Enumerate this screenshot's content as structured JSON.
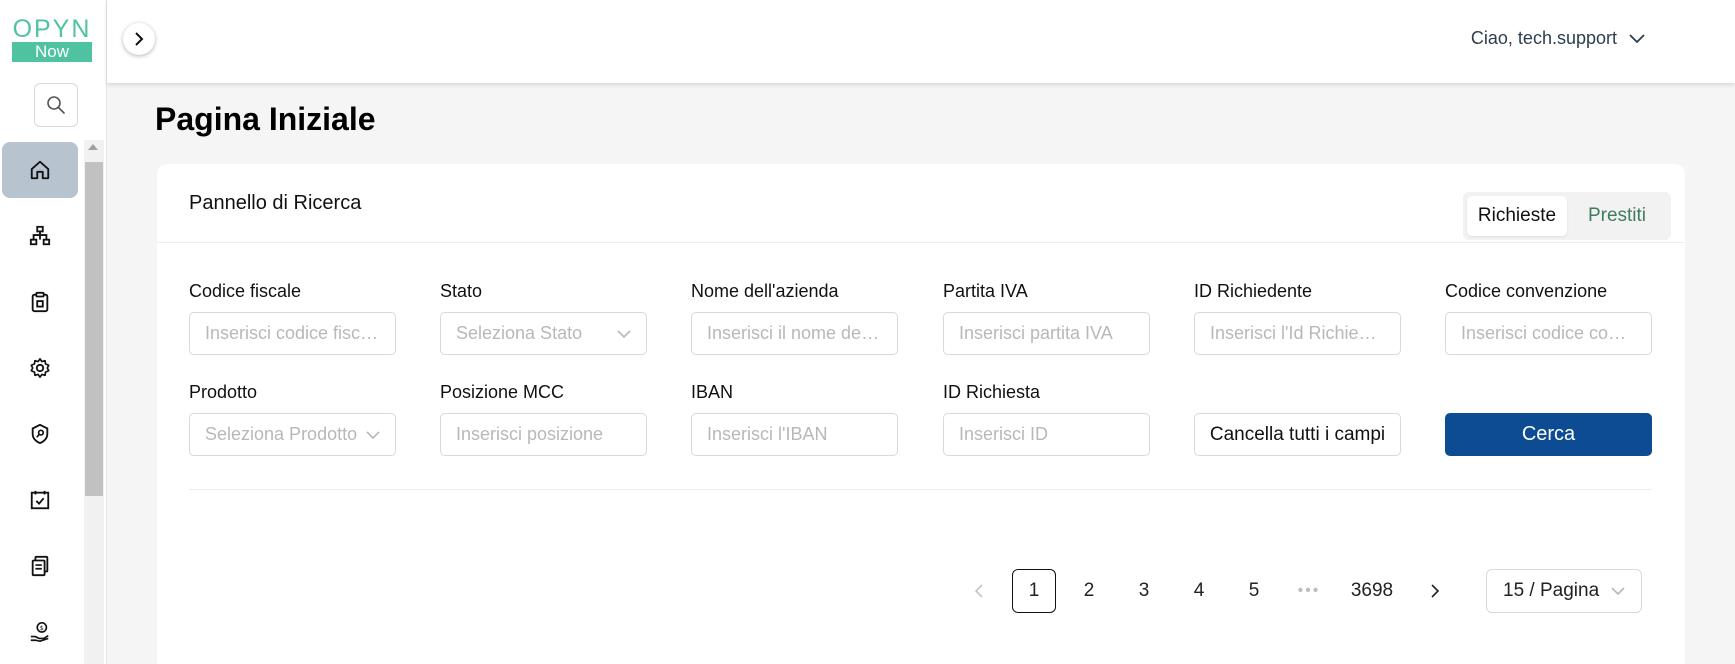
{
  "logo": {
    "top": "OPYN",
    "bottom": "Now"
  },
  "sidebar": {
    "items": [
      {
        "icon": "home-icon",
        "active": true
      },
      {
        "icon": "sitemap-icon",
        "active": false
      },
      {
        "icon": "clipboard-icon",
        "active": false
      },
      {
        "icon": "gear-icon",
        "active": false
      },
      {
        "icon": "shield-key-icon",
        "active": false
      },
      {
        "icon": "calendar-check-icon",
        "active": false
      },
      {
        "icon": "documents-icon",
        "active": false
      },
      {
        "icon": "hand-coin-icon",
        "active": false
      }
    ]
  },
  "header": {
    "user_greeting": "Ciao, tech.support"
  },
  "page": {
    "title": "Pagina Iniziale"
  },
  "search_panel": {
    "title": "Pannello di Ricerca",
    "tabs": [
      {
        "label": "Richieste",
        "selected": true
      },
      {
        "label": "Prestiti",
        "selected": false
      }
    ],
    "fields": [
      {
        "label": "Codice fiscale",
        "placeholder": "Inserisci codice fiscale",
        "type": "input"
      },
      {
        "label": "Stato",
        "placeholder": "Seleziona Stato",
        "type": "select"
      },
      {
        "label": "Nome dell'azienda",
        "placeholder": "Inserisci il nome dell'azienda",
        "type": "input"
      },
      {
        "label": "Partita IVA",
        "placeholder": "Inserisci partita IVA",
        "type": "input"
      },
      {
        "label": "ID Richiedente",
        "placeholder": "Inserisci l'Id Richiedente",
        "type": "input"
      },
      {
        "label": "Codice convenzione",
        "placeholder": "Inserisci codice convenzione",
        "type": "input"
      },
      {
        "label": "Prodotto",
        "placeholder": "Seleziona Prodotto",
        "type": "select"
      },
      {
        "label": "Posizione MCC",
        "placeholder": "Inserisci posizione",
        "type": "input"
      },
      {
        "label": "IBAN",
        "placeholder": "Inserisci l'IBAN",
        "type": "input"
      },
      {
        "label": "ID Richiesta",
        "placeholder": "Inserisci ID",
        "type": "input"
      }
    ],
    "clear_label": "Cancella tutti i campi",
    "search_label": "Cerca"
  },
  "pagination": {
    "pages": [
      "1",
      "2",
      "3",
      "4",
      "5"
    ],
    "ellipsis": "•••",
    "last_page": "3698",
    "current": "1",
    "page_size": "15 / Pagina"
  },
  "colors": {
    "brand": "#4fc3a1",
    "primary": "#0d4c92",
    "active_nav": "#b7c3cf",
    "tab_other": "#3e7d5c"
  }
}
